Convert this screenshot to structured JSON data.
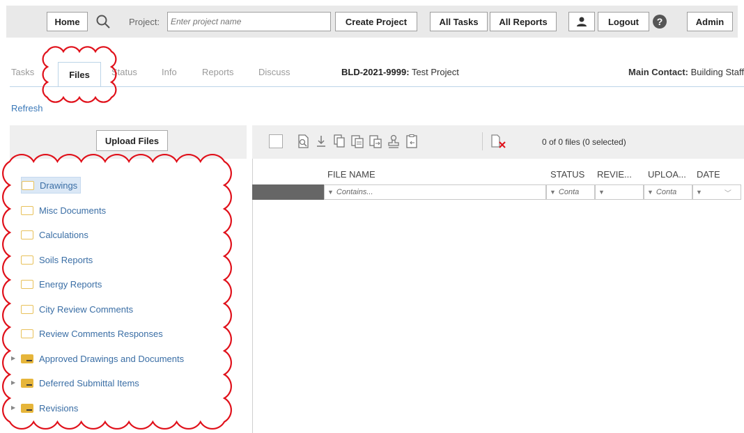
{
  "topbar": {
    "home_label": "Home",
    "project_label": "Project:",
    "project_placeholder": "Enter project name",
    "create_project_label": "Create Project",
    "all_tasks_label": "All Tasks",
    "all_reports_label": "All Reports",
    "logout_label": "Logout",
    "admin_label": "Admin"
  },
  "tabs": [
    "Tasks",
    "Files",
    "Status",
    "Info",
    "Reports",
    "Discuss"
  ],
  "active_tab": "Files",
  "project": {
    "id": "BLD-2021-9999:",
    "name": "Test Project"
  },
  "contact": {
    "label": "Main Contact:",
    "value": "Building Staff"
  },
  "refresh_label": "Refresh",
  "upload_label": "Upload Files",
  "folders": [
    {
      "label": "Drawings",
      "icon": "folder-outline-icon",
      "selected": true,
      "expandable": false
    },
    {
      "label": "Misc Documents",
      "icon": "folder-outline-icon",
      "selected": false,
      "expandable": false
    },
    {
      "label": "Calculations",
      "icon": "folder-outline-icon",
      "selected": false,
      "expandable": false
    },
    {
      "label": "Soils Reports",
      "icon": "folder-outline-icon",
      "selected": false,
      "expandable": false
    },
    {
      "label": "Energy Reports",
      "icon": "folder-outline-icon",
      "selected": false,
      "expandable": false
    },
    {
      "label": "City Review Comments",
      "icon": "folder-outline-icon",
      "selected": false,
      "expandable": false
    },
    {
      "label": "Review Comments Responses",
      "icon": "folder-outline-icon",
      "selected": false,
      "expandable": false
    },
    {
      "label": "Approved Drawings and Documents",
      "icon": "folder-filled-icon",
      "selected": false,
      "expandable": true
    },
    {
      "label": "Deferred Submittal Items",
      "icon": "folder-filled-icon",
      "selected": false,
      "expandable": true
    },
    {
      "label": "Revisions",
      "icon": "folder-filled-icon",
      "selected": false,
      "expandable": true
    }
  ],
  "file_count_text": "0 of 0 files (0 selected)",
  "columns": {
    "file_name": "FILE NAME",
    "status": "STATUS",
    "reviewer": "REVIE...",
    "uploader": "UPLOA...",
    "date": "DATE"
  },
  "filters": {
    "file_name": "Contains...",
    "status": "Conta",
    "uploader": "Conta"
  },
  "colors": {
    "link": "#3a78b8",
    "folder": "#e6b53a",
    "annotation": "#e0101a",
    "toolbar_bg": "#efefef"
  }
}
